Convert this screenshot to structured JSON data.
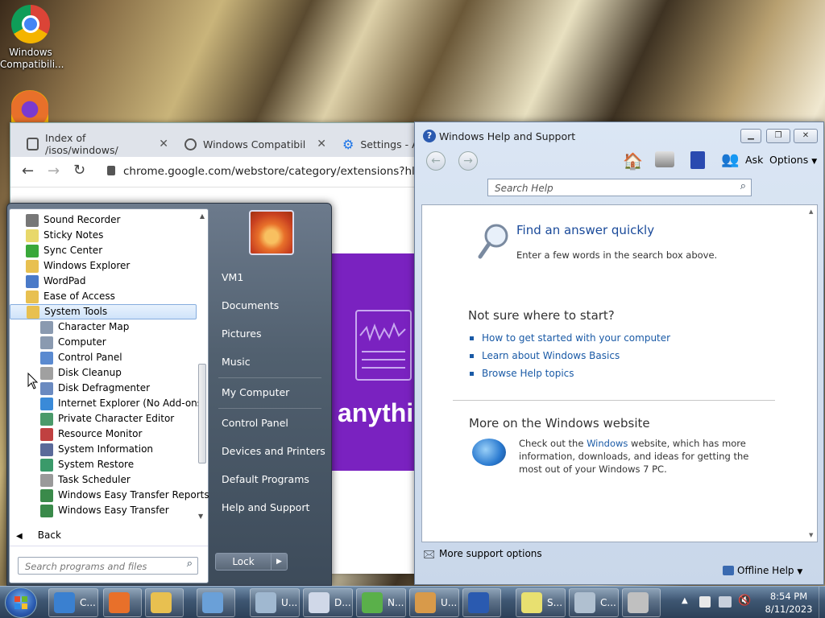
{
  "desktop": {
    "icons": [
      {
        "label": "Windows Compatibili...",
        "icon": "chrome-icon"
      },
      {
        "label": "",
        "icon": "firefox-icon"
      }
    ]
  },
  "chrome": {
    "tabs": [
      {
        "title": "Index of /isos/windows/",
        "icon": "server-icon"
      },
      {
        "title": "Windows Compatibility",
        "icon": "globe-icon"
      },
      {
        "title": "Settings - Ap",
        "icon": "gear-icon"
      }
    ],
    "url": "chrome.google.com/webstore/category/extensions?hl=en",
    "banner_text": "anythi"
  },
  "help": {
    "title": "Windows Help and Support",
    "toolbar": {
      "ask": "Ask",
      "options": "Options"
    },
    "search_placeholder": "Search Help",
    "find_title": "Find an answer quickly",
    "find_sub": "Enter a few words in the search box above.",
    "start_title": "Not sure where to start?",
    "links": [
      "How to get started with your computer",
      "Learn about Windows Basics",
      "Browse Help topics"
    ],
    "more_title": "More on the Windows website",
    "more_pre": "Check out the ",
    "more_link": "Windows",
    "more_post": " website, which has more information, downloads, and ideas for getting the most out of your Windows 7 PC.",
    "footer": "More support options",
    "offline": "Offline Help"
  },
  "startmenu": {
    "programs": [
      {
        "label": "Sound Recorder",
        "indent": 0,
        "color": "#777"
      },
      {
        "label": "Sticky Notes",
        "indent": 0,
        "color": "#e8d86a"
      },
      {
        "label": "Sync Center",
        "indent": 0,
        "color": "#3aa83a"
      },
      {
        "label": "Windows Explorer",
        "indent": 0,
        "color": "#e8c050"
      },
      {
        "label": "WordPad",
        "indent": 0,
        "color": "#4a7ac8"
      },
      {
        "label": "Ease of Access",
        "indent": 0,
        "color": "#e8c050"
      },
      {
        "label": "System Tools",
        "indent": 0,
        "color": "#e8c050",
        "selected": true
      },
      {
        "label": "Character Map",
        "indent": 1,
        "color": "#8a9ab0"
      },
      {
        "label": "Computer",
        "indent": 1,
        "color": "#8a9ab0"
      },
      {
        "label": "Control Panel",
        "indent": 1,
        "color": "#5a8ad0"
      },
      {
        "label": "Disk Cleanup",
        "indent": 1,
        "color": "#a0a0a0"
      },
      {
        "label": "Disk Defragmenter",
        "indent": 1,
        "color": "#6a8ac0"
      },
      {
        "label": "Internet Explorer (No Add-ons)",
        "indent": 1,
        "color": "#3a8ad8"
      },
      {
        "label": "Private Character Editor",
        "indent": 1,
        "color": "#4a9a6a"
      },
      {
        "label": "Resource Monitor",
        "indent": 1,
        "color": "#c04040"
      },
      {
        "label": "System Information",
        "indent": 1,
        "color": "#5a6a9a"
      },
      {
        "label": "System Restore",
        "indent": 1,
        "color": "#3a9a6a"
      },
      {
        "label": "Task Scheduler",
        "indent": 1,
        "color": "#9a9a9a"
      },
      {
        "label": "Windows Easy Transfer Reports",
        "indent": 1,
        "color": "#3a8a4a"
      },
      {
        "label": "Windows Easy Transfer",
        "indent": 1,
        "color": "#3a8a4a"
      }
    ],
    "back": "Back",
    "search_placeholder": "Search programs and files",
    "right": [
      "VM1",
      "Documents",
      "Pictures",
      "Music",
      "My Computer",
      "Control Panel",
      "Devices and Printers",
      "Default Programs",
      "Help and Support"
    ],
    "lock": "Lock"
  },
  "taskbar": {
    "buttons": [
      {
        "label": "C...",
        "icon": "chrome-icon",
        "color": "#3a80d0"
      },
      {
        "label": "",
        "icon": "firefox-icon",
        "color": "#e8702a"
      },
      {
        "label": "",
        "icon": "folder-icon",
        "color": "#e8c050"
      },
      {
        "label": "",
        "icon": "network-icon",
        "color": "#6aa0d8"
      },
      {
        "label": "U...",
        "icon": "notepad-icon",
        "color": "#a0b8d0"
      },
      {
        "label": "D...",
        "icon": "document-icon",
        "color": "#d0d8e8"
      },
      {
        "label": "N...",
        "icon": "frog-icon",
        "color": "#5ab04a"
      },
      {
        "label": "U...",
        "icon": "paint-icon",
        "color": "#d89a4a"
      },
      {
        "label": "",
        "icon": "help-icon",
        "color": "#2a5ab0"
      },
      {
        "label": "S...",
        "icon": "sticky-notes-icon",
        "color": "#e8e070"
      },
      {
        "label": "C...",
        "icon": "calculator-icon",
        "color": "#b0c0d0"
      },
      {
        "label": "",
        "icon": "fax-icon",
        "color": "#c0c0c0"
      }
    ],
    "time": "8:54 PM",
    "date": "8/11/2023"
  }
}
